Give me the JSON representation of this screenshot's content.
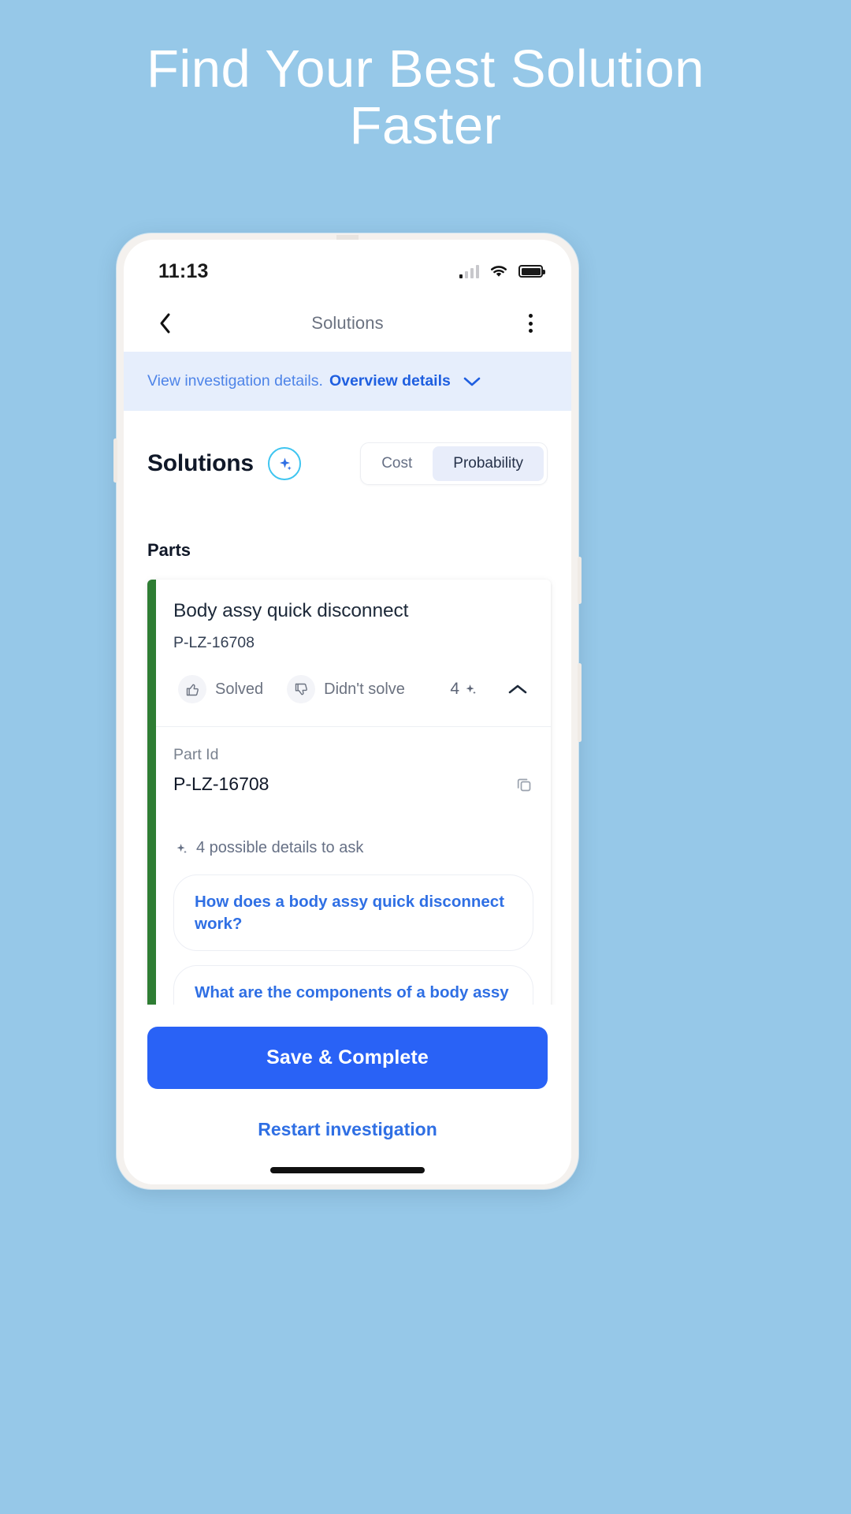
{
  "marketing": {
    "headline": "Find Your Best Solution Faster",
    "background_color": "#96c8e8"
  },
  "status_bar": {
    "time": "11:13",
    "signal_icon": "signal-bars-icon",
    "wifi_icon": "wifi-icon",
    "battery_icon": "battery-full-icon"
  },
  "nav": {
    "back_icon": "chevron-left-icon",
    "title": "Solutions",
    "menu_icon": "more-vertical-icon"
  },
  "banner": {
    "text": "View investigation details.",
    "link": "Overview details",
    "chevron_icon": "chevron-down-icon",
    "background_color": "#e6eefc",
    "link_color": "#1f5fe0"
  },
  "solutions": {
    "title": "Solutions",
    "sparkle_icon": "sparkle-ai-icon",
    "toggle": {
      "options": [
        "Cost",
        "Probability"
      ],
      "selected": "Probability"
    }
  },
  "parts": {
    "section_label": "Parts",
    "card": {
      "accent_color": "#2e7d33",
      "name": "Body assy quick disconnect",
      "part_number": "P-LZ-16708",
      "solved_label": "Solved",
      "solved_icon": "thumbs-up-icon",
      "didnt_solve_label": "Didn't solve",
      "didnt_solve_icon": "thumbs-down-icon",
      "ai_count": "4",
      "ai_count_icon": "sparkle-ai-icon",
      "collapse_icon": "chevron-up-icon",
      "detail_label": "Part Id",
      "detail_value": "P-LZ-16708",
      "copy_icon": "copy-icon",
      "ask_icon": "sparkle-ai-icon",
      "ask_text": "4 possible details to ask",
      "questions": [
        "How does a body assy quick disconnect work?",
        "What are the components of a body assy quick disconnect?"
      ]
    }
  },
  "footer": {
    "primary_label": "Save & Complete",
    "primary_color": "#2962f6",
    "link_label": "Restart investigation"
  }
}
